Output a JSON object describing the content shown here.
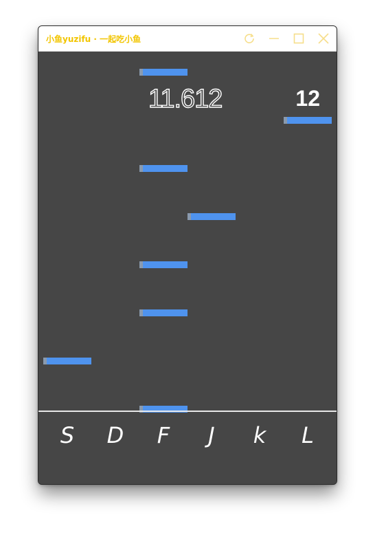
{
  "window": {
    "title": "小鱼yuzifu · 一起吃小鱼",
    "title_color": "#f2c500",
    "controls": [
      "refresh-icon",
      "minimize-icon",
      "maximize-icon",
      "close-icon"
    ]
  },
  "game": {
    "timer": "11.612",
    "score": "12",
    "background": "#464646",
    "note_color": "#4f93ee",
    "lanes": [
      "S",
      "D",
      "F",
      "J",
      "k",
      "L"
    ],
    "notes": [
      {
        "lane": "F"
      },
      {
        "lane": "L"
      },
      {
        "lane": "F"
      },
      {
        "lane": "J"
      },
      {
        "lane": "F"
      },
      {
        "lane": "F"
      },
      {
        "lane": "S"
      },
      {
        "lane": "F"
      }
    ]
  }
}
